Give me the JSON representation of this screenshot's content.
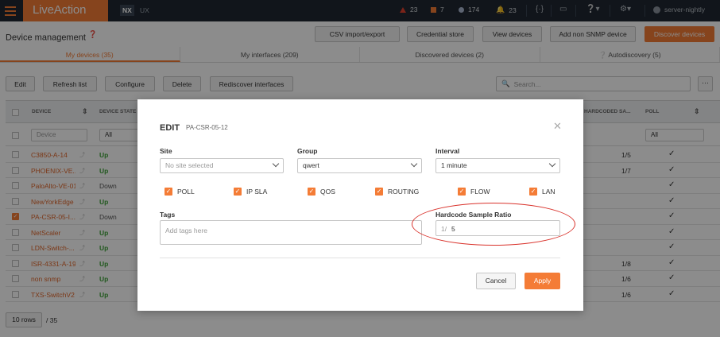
{
  "topbar": {
    "brand": "LiveAction",
    "env_badge": "NX",
    "env_secondary": "UX",
    "alerts_critical": "23",
    "alerts_warning": "7",
    "alerts_info": "174",
    "notifications": "23",
    "user": "server-nightly"
  },
  "header": {
    "title": "Device management",
    "buttons": [
      "CSV import/export",
      "Credential store",
      "View devices",
      "Add non SNMP device",
      "Discover devices"
    ]
  },
  "tabs": [
    "My devices (35)",
    "My interfaces (209)",
    "Discovered devices (2)",
    "Autodiscovery (5)"
  ],
  "toolbar": {
    "buttons": [
      "Edit",
      "Refresh list",
      "Configure",
      "Delete",
      "Rediscover interfaces"
    ],
    "search_placeholder": "Search..."
  },
  "table": {
    "columns": [
      "DEVICE",
      "DEVICE STATE",
      "HARDCODED SA...",
      "POLL"
    ],
    "filter_device_placeholder": "Device",
    "filter_state": "All",
    "filter_poll": "All",
    "rows": [
      {
        "device": "C3850-A-14",
        "state": "Up",
        "ratio": "1/5",
        "poll": true,
        "checked": false
      },
      {
        "device": "PHOENIX-VE...",
        "state": "Up",
        "ratio": "1/7",
        "poll": true,
        "checked": false
      },
      {
        "device": "PaloAlto-VE-01",
        "state": "Down",
        "ratio": "",
        "poll": true,
        "checked": false
      },
      {
        "device": "NewYorkEdge",
        "state": "Up",
        "ratio": "",
        "poll": true,
        "checked": false
      },
      {
        "device": "PA-CSR-05-I...",
        "state": "Down",
        "ratio": "",
        "poll": true,
        "checked": true
      },
      {
        "device": "NetScaler",
        "state": "Up",
        "ratio": "",
        "poll": true,
        "checked": false
      },
      {
        "device": "LDN-Switch-...",
        "state": "Up",
        "ratio": "",
        "poll": true,
        "checked": false
      },
      {
        "device": "ISR-4331-A-19",
        "state": "Up",
        "ratio": "1/8",
        "poll": true,
        "checked": false
      },
      {
        "device": "non snmp",
        "state": "Up",
        "ratio": "1/6",
        "poll": true,
        "checked": false
      },
      {
        "device": "TXS-SwitchV2",
        "state": "Up",
        "ratio": "1/6",
        "poll": true,
        "checked": false
      }
    ],
    "rows_per_page": "10 rows",
    "total": "/ 35"
  },
  "modal": {
    "title": "EDIT",
    "subtitle": "PA-CSR-05-12",
    "site_label": "Site",
    "site_placeholder": "No site selected",
    "group_label": "Group",
    "group_value": "qwert",
    "interval_label": "Interval",
    "interval_value": "1 minute",
    "checks": [
      "POLL",
      "IP SLA",
      "QOS",
      "ROUTING",
      "FLOW",
      "LAN"
    ],
    "tags_label": "Tags",
    "tags_placeholder": "Add tags here",
    "ratio_label": "Hardcode Sample Ratio",
    "ratio_prefix": "1/",
    "ratio_value": "5",
    "cancel": "Cancel",
    "apply": "Apply"
  },
  "colors": {
    "accent": "#f47c36",
    "topbar": "#1f2732",
    "status_up": "#3fa33a",
    "highlight": "#d9322b"
  }
}
